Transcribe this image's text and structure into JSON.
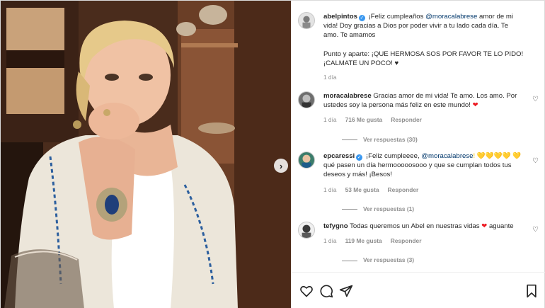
{
  "post": {
    "next_icon_glyph": "›"
  },
  "caption": {
    "username": "abelpintos",
    "verified_glyph": "✓",
    "part1": "¡Feliz cumpleaños ",
    "mention": "@moracalabrese",
    "part2": " amor de mi vida! Doy gracias a Dios por poder vivir a tu lado cada día. Te amo. Te amamos",
    "part3": "Punto y aparte: ¡QUE HERMOSA SOS POR FAVOR TE LO PIDO! ¡CALMATE UN POCO! ♥",
    "time": "1 día"
  },
  "comments": [
    {
      "username": "moracalabrese",
      "text": "Gracias amor de mi vida! Te amo. Los amo. Por ustedes soy la persona más feliz en este mundo!",
      "emoji": "❤",
      "time": "1 día",
      "likes": "716 Me gusta",
      "reply": "Responder",
      "view_replies": "Ver respuestas (30)"
    },
    {
      "username": "epcaressi",
      "verified_glyph": "✓",
      "text_pre": "¡Feliz cumpleeee, ",
      "mention": "@moracalabrese",
      "hearts_inline": "! 💛💛💛💛",
      "text_post": "💛 qué pasen un día hermooooosooo y que se cumplan todos tus deseos y más! ¡Besos!",
      "time": "1 día",
      "likes": "53 Me gusta",
      "reply": "Responder",
      "view_replies": "Ver respuestas (1)"
    },
    {
      "username": "tefygno",
      "text": "Todas queremos un Abel en nuestras vidas",
      "emoji": "❤",
      "text_after": "aguante",
      "time": "1 día",
      "likes": "119 Me gusta",
      "reply": "Responder",
      "view_replies": "Ver respuestas (3)"
    }
  ],
  "like_icon_glyph": "♡",
  "colors": {
    "mention": "#00376b",
    "verified": "#3897f0",
    "red_heart": "#ed1c24",
    "muted": "#8e8e8e"
  }
}
